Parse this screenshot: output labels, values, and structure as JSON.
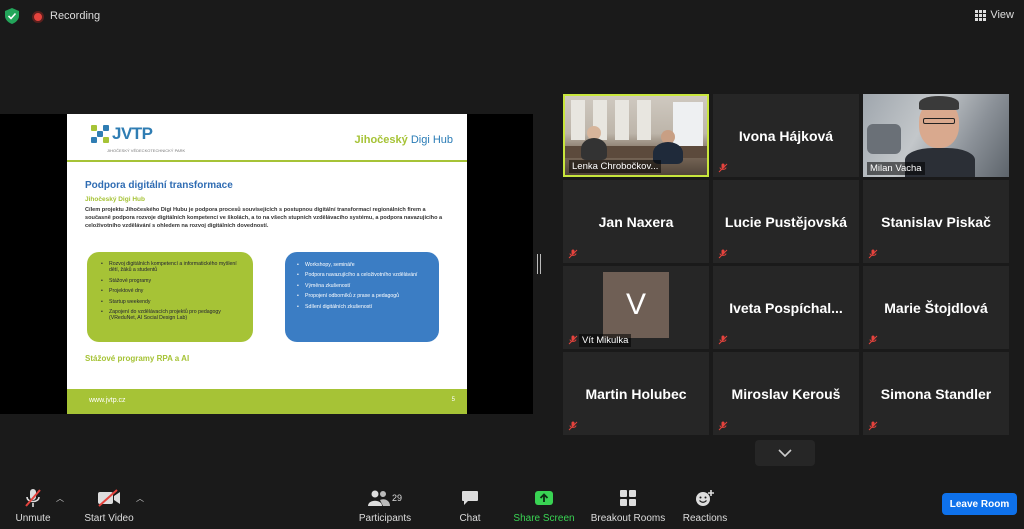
{
  "topbar": {
    "recording_label": "Recording",
    "view_label": "View"
  },
  "slide": {
    "logo_text": "JVTP",
    "logo_subtitle": "JIHOČESKÝ VĚDECKOTECHNICKÝ PARK",
    "digi_logo_prefix": "Jihočeský",
    "digi_logo_suffix": "Digi Hub",
    "title": "Podpora digitální transformace",
    "subtitle": "Jihočeský Digi Hub",
    "paragraph": "Cílem projektu Jihočeského Digi Hubu je podpora procesů souvisejících s postupnou digitální transformací regionálních firem a současně podpora rozvoje digitálních kompetencí ve školách, a to na všech stupních vzdělávacího systému, a podpora navazujícího a celoživotního vzdělávání s ohledem na rozvoj digitálních dovedností.",
    "green_items": [
      "Rozvoj digitálních kompetencí a informatického myšlení dětí, žáků a studentů",
      "Stážové programy",
      "Projektové dny",
      "Startup weekendy",
      "Zapojení do vzdělávacích projektů pro pedagogy (VReduNet, AI Social Design Lab)"
    ],
    "blue_items": [
      "Workshopy, semináře",
      "Podpora navazujícího a celoživotního vzdělávání",
      "Výměna zkušeností",
      "Propojení odborníků z praxe a pedagogů",
      "Sdílení digitálních zkušeností"
    ],
    "footer_title": "Stážové programy RPA a AI",
    "footer_url": "www.jvtp.cz",
    "page_number": "5"
  },
  "participants": [
    {
      "name": "Lenka Chrobočkov...",
      "type": "video-room",
      "active": true
    },
    {
      "name": "Ivona Hájková",
      "type": "name"
    },
    {
      "name": "Milan Vacha",
      "type": "video-person"
    },
    {
      "name": "Jan Naxera",
      "type": "name"
    },
    {
      "name": "Lucie Pustějovská",
      "type": "name"
    },
    {
      "name": "Stanislav Piskač",
      "type": "name"
    },
    {
      "name": "Vít Mikulka",
      "type": "avatar",
      "initial": "V"
    },
    {
      "name": "Iveta  Pospíchal...",
      "type": "name"
    },
    {
      "name": "Marie Štojdlová",
      "type": "name"
    },
    {
      "name": "Martin Holubec",
      "type": "name"
    },
    {
      "name": "Miroslav Kerouš",
      "type": "name"
    },
    {
      "name": "Simona Standler",
      "type": "name"
    }
  ],
  "toolbar": {
    "unmute_label": "Unmute",
    "start_video_label": "Start Video",
    "participants_label": "Participants",
    "participants_count": "29",
    "chat_label": "Chat",
    "share_screen_label": "Share Screen",
    "breakout_label": "Breakout Rooms",
    "reactions_label": "Reactions",
    "leave_label": "Leave Room"
  },
  "colors": {
    "background": "#1a1a1a",
    "tile": "#262626",
    "active_speaker": "#c8e63c",
    "slide_green": "#a6c336",
    "slide_blue": "#3b7dc4",
    "share_green": "#39d353",
    "leave_blue": "#0e71eb",
    "recording_red": "#e5433d"
  },
  "icons": {
    "security": "shield-check-icon",
    "recording": "record-dot-icon",
    "view": "grid-icon",
    "mic": "mic-off-icon",
    "video": "video-off-icon",
    "participants": "people-icon",
    "chat": "chat-bubble-icon",
    "share": "share-arrow-icon",
    "breakout": "four-squares-icon",
    "reactions": "smiley-plus-icon",
    "more": "chevron-down-icon"
  }
}
